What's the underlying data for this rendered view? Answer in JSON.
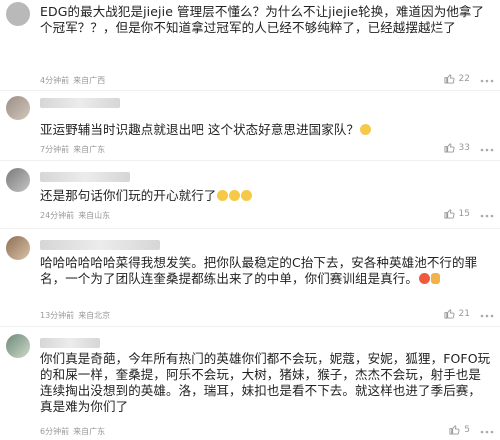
{
  "comments": [
    {
      "text": "EDG的最大战犯是jiejie 管理层不懂么？为什么不让jiejie轮换，难道因为他拿了个冠军？？，但是你不知道拿过冠军的人已经不够纯粹了，已经越摆越烂了",
      "time": "4分钟前",
      "location": "来自广西",
      "likes": "22"
    },
    {
      "text": "亚运野辅当时识趣点就退出吧 这个状态好意思进国家队？",
      "time": "7分钟前",
      "location": "来自广东",
      "likes": "33"
    },
    {
      "text": "还是那句话你们玩的开心就行了",
      "time": "24分钟前",
      "location": "来自山东",
      "likes": "15"
    },
    {
      "text": "哈哈哈哈哈哈菜得我想发笑。把你队最稳定的C抬下去，安各种英雄池不行的罪名，一个为了团队连奎桑提都练出来了的中单，你们赛训组是真行。",
      "time": "13分钟前",
      "location": "来自北京",
      "likes": "21"
    },
    {
      "text": "你们真是奇葩，今年所有热门的英雄你们都不会玩，妮蔻，安妮，狐狸，FOFO玩的和屎一样，奎桑提，阿乐不会玩，大树，猪妹，猴子，杰杰不会玩，射手也是连续掏出没想到的英雄。洛，瑞耳，妹扣也是看不下去。就这样也进了季后赛，真是难为你们了",
      "time": "6分钟前",
      "location": "来自广东",
      "likes": "5"
    }
  ],
  "icons": {
    "like": "thumbs-up-icon",
    "more": "more-dots-icon",
    "emoji": "emoji-icon"
  },
  "colors": {
    "text": "#222222",
    "meta": "#9a9a9a"
  }
}
